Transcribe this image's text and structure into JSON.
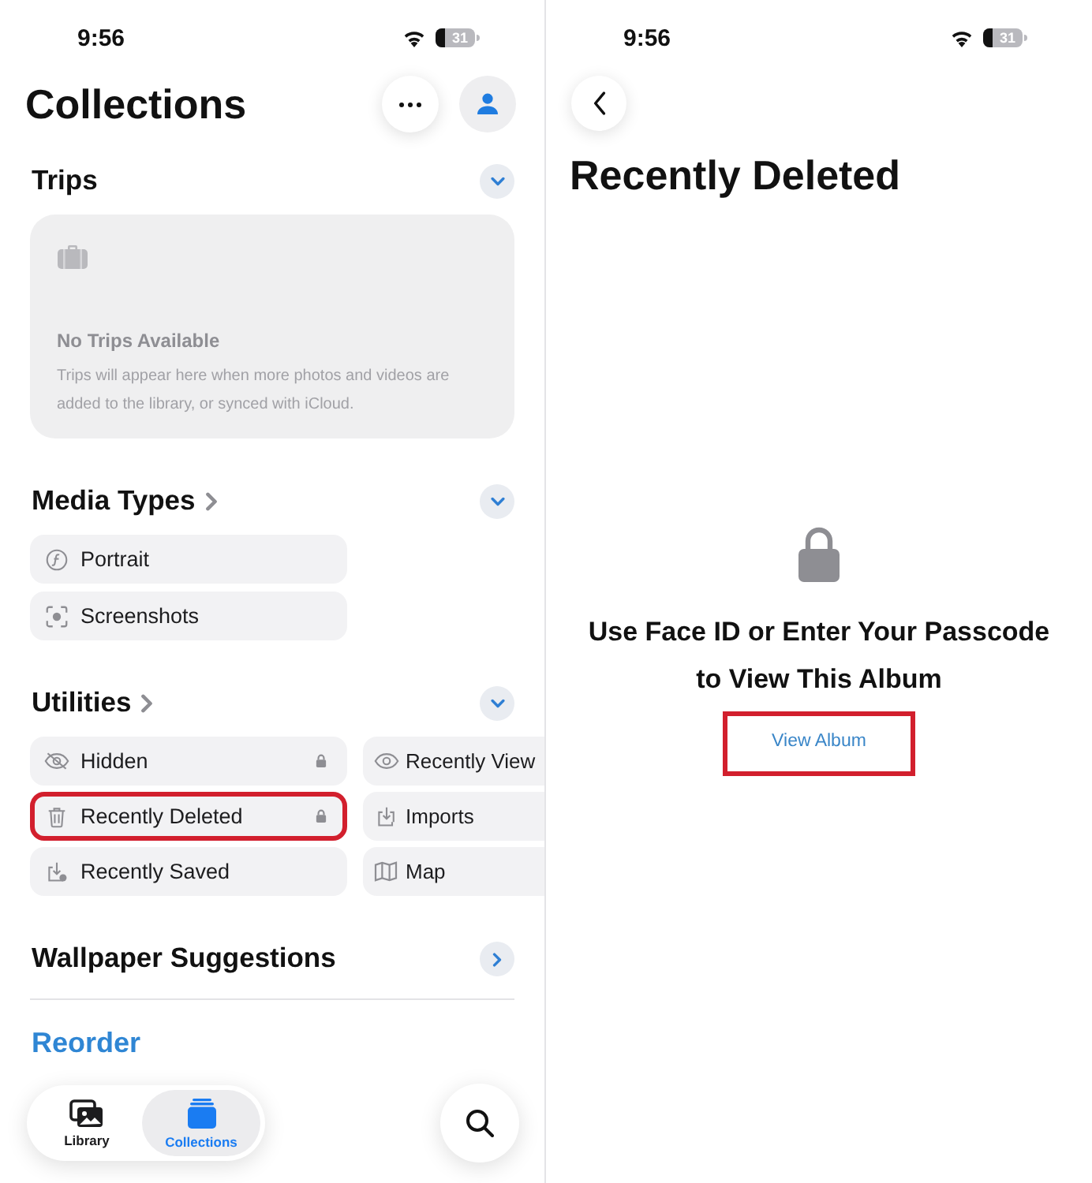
{
  "collections_screen": {
    "status_bar": {
      "time": "9:56",
      "battery": "31"
    },
    "title": "Collections",
    "sections": [
      {
        "kind": "trips",
        "title": "Trips",
        "navigable": false,
        "expanded": true,
        "empty_state": {
          "title": "No Trips Available",
          "text": "Trips will appear here when more photos and videos are added to the library, or synced with iCloud."
        }
      },
      {
        "kind": "list",
        "title": "Media Types",
        "navigable": true,
        "expanded": true,
        "items": [
          {
            "label": "Portrait",
            "locked": false,
            "highlighted": false
          },
          {
            "label": "Screenshots",
            "locked": false,
            "highlighted": false
          }
        ]
      },
      {
        "kind": "grid",
        "title": "Utilities",
        "navigable": true,
        "expanded": true,
        "items": [
          {
            "label": "Hidden",
            "locked": true,
            "highlighted": false
          },
          {
            "label": "Recently View",
            "locked": false,
            "highlighted": false
          },
          {
            "label": "Recently Deleted",
            "locked": true,
            "highlighted": true
          },
          {
            "label": "Imports",
            "locked": false,
            "highlighted": false
          },
          {
            "label": "Recently Saved",
            "locked": false,
            "highlighted": false
          },
          {
            "label": "Map",
            "locked": false,
            "highlighted": false
          }
        ]
      },
      {
        "kind": "row",
        "title": "Wallpaper Suggestions",
        "navigable": false,
        "expanded": false
      }
    ],
    "reorder": "Reorder",
    "tab_bar": {
      "tabs": [
        {
          "label": "Library",
          "selected": false
        },
        {
          "label": "Collections",
          "selected": true
        }
      ]
    }
  },
  "album_screen": {
    "status_bar": {
      "time": "9:56",
      "battery": "31"
    },
    "title": "Recently Deleted",
    "message": "Use Face ID or Enter Your Passcode to View This Album",
    "button": {
      "label": "View Album",
      "highlighted": true
    }
  }
}
